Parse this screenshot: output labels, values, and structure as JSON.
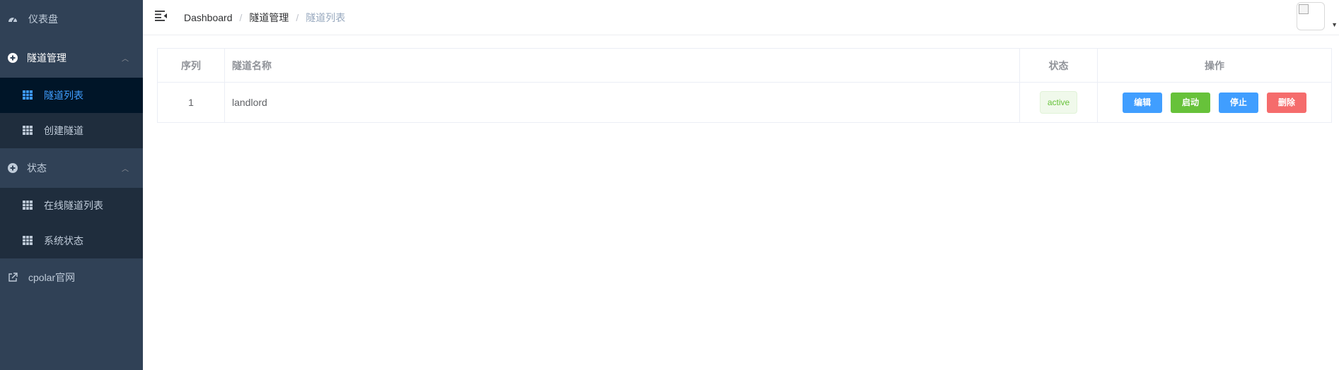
{
  "sidebar": {
    "dashboard_label": "仪表盘",
    "tunnel_group": {
      "title": "隧道管理",
      "items": [
        {
          "label": "隧道列表"
        },
        {
          "label": "创建隧道"
        }
      ]
    },
    "status_group": {
      "title": "状态",
      "items": [
        {
          "label": "在线隧道列表"
        },
        {
          "label": "系统状态"
        }
      ]
    },
    "external_label": "cpolar官网"
  },
  "breadcrumb": {
    "home": "Dashboard",
    "section": "隧道管理",
    "current": "隧道列表",
    "separator": "/"
  },
  "table": {
    "headers": {
      "index": "序列",
      "name": "隧道名称",
      "status": "状态",
      "actions": "操作"
    },
    "rows": [
      {
        "index": "1",
        "name": "landlord",
        "status": "active",
        "actions": {
          "edit": "编辑",
          "start": "启动",
          "stop": "停止",
          "delete": "删除"
        }
      }
    ]
  },
  "colors": {
    "sidebar_bg": "#304156",
    "submenu_bg": "#1f2d3d",
    "active_item_bg": "#001528",
    "active_text": "#409eff",
    "btn_primary": "#409eff",
    "btn_success": "#67c23a",
    "btn_danger": "#f56c6c"
  },
  "icons": {
    "dashboard": "speedometer-icon",
    "tunnel_group": "plus-circle-icon",
    "status_group": "plus-circle-icon",
    "sub_items": "table-grid-icon",
    "external": "external-link-icon",
    "hamburger": "menu-fold-icon",
    "avatar": "broken-image-icon",
    "caret": "caret-down-icon"
  }
}
